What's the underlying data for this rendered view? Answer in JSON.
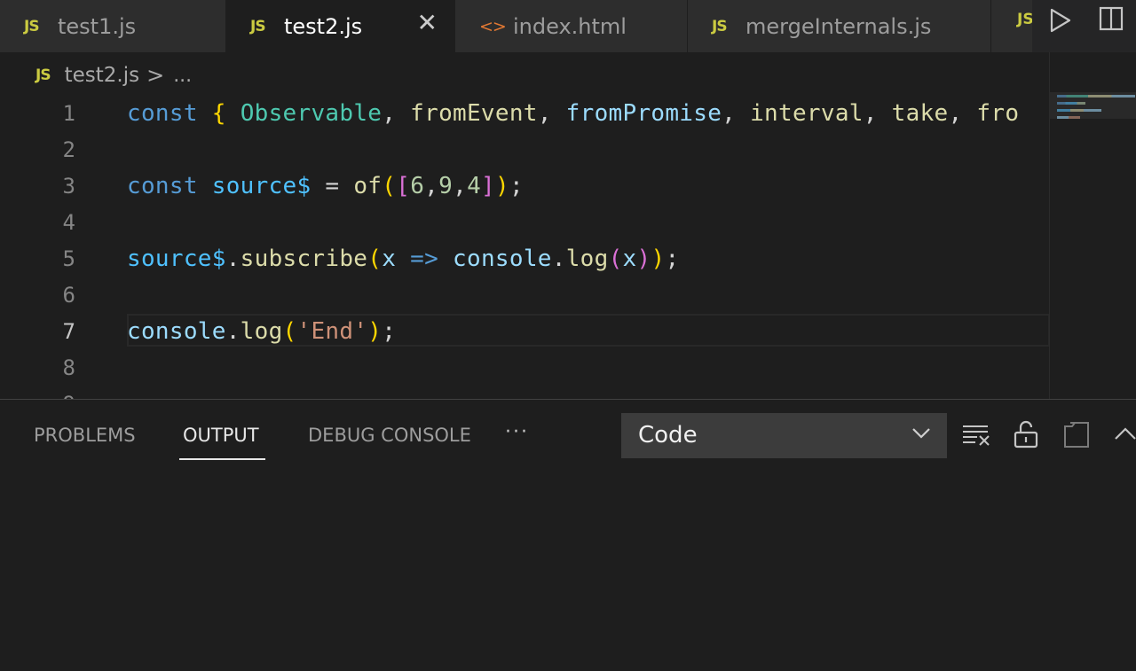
{
  "tabs": [
    {
      "icon": "JS",
      "label": "test1.js"
    },
    {
      "icon": "JS",
      "label": "test2.js",
      "close": "✕"
    },
    {
      "icon": "<>",
      "label": "index.html"
    },
    {
      "icon": "JS",
      "label": "mergeInternals.js"
    }
  ],
  "tab_overflow_icon": "JS",
  "breadcrumb": {
    "icon": "JS",
    "file": "test2.js",
    "separator": ">",
    "more": "..."
  },
  "editor": {
    "line_numbers": [
      "1",
      "2",
      "3",
      "4",
      "5",
      "6",
      "7",
      "8"
    ],
    "lines": [
      "const { Observable, fromEvent, fromPromise, interval, take, from",
      "",
      "const source$ = of([6,9,4]);",
      "",
      "source$.subscribe(x => console.log(x));",
      "",
      "console.log('End');",
      ""
    ]
  },
  "panel": {
    "tabs": [
      "PROBLEMS",
      "OUTPUT",
      "DEBUG CONSOLE"
    ],
    "more": "···",
    "output_select": "Code"
  },
  "icons": {
    "run": "run-icon",
    "split": "split-editor-icon",
    "clear": "clear-output-icon",
    "lock": "lock-icon",
    "copy": "open-log-icon",
    "maximize": "chevron-up-icon"
  },
  "colors": {
    "keyword": "#569cd6",
    "class": "#4ec9b0",
    "function": "#dcdcaa",
    "variable": "#9cdcfe",
    "string": "#ce9178",
    "number": "#b5cea8"
  }
}
